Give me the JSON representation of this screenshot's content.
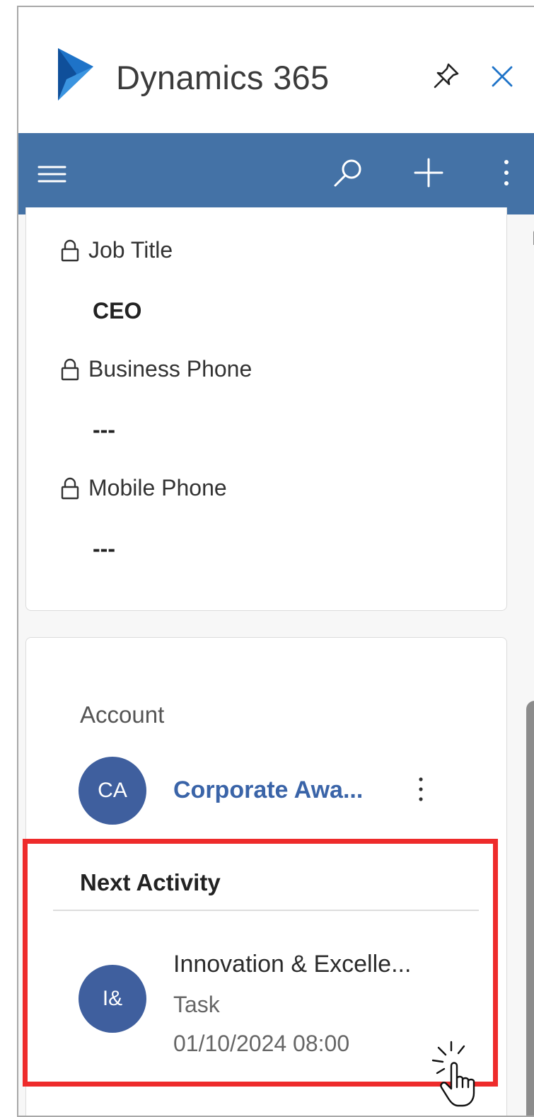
{
  "app": {
    "title": "Dynamics 365",
    "icons": {
      "logo": "dynamics-logo",
      "pin": "pin-icon",
      "close": "close-icon"
    }
  },
  "command_bar": {
    "background": "#4472a6",
    "icons": [
      "hamburger-menu-icon",
      "search-icon",
      "add-icon",
      "more-vertical-icon"
    ]
  },
  "contact_fields": [
    {
      "label": "Job Title",
      "value": "CEO"
    },
    {
      "label": "Business Phone",
      "value": "---"
    },
    {
      "label": "Mobile Phone",
      "value": "---"
    }
  ],
  "account": {
    "label": "Account",
    "avatar_initials": "CA",
    "name": "Corporate Awa...",
    "link_color": "#3a64a8"
  },
  "next_activity": {
    "title": "Next Activity",
    "avatar_initials": "I&",
    "name": "Innovation & Excelle...",
    "type": "Task",
    "due": "01/10/2024 08:00"
  },
  "colors": {
    "avatar": "#3f5f9e",
    "highlight_border": "#ee2b2b"
  }
}
